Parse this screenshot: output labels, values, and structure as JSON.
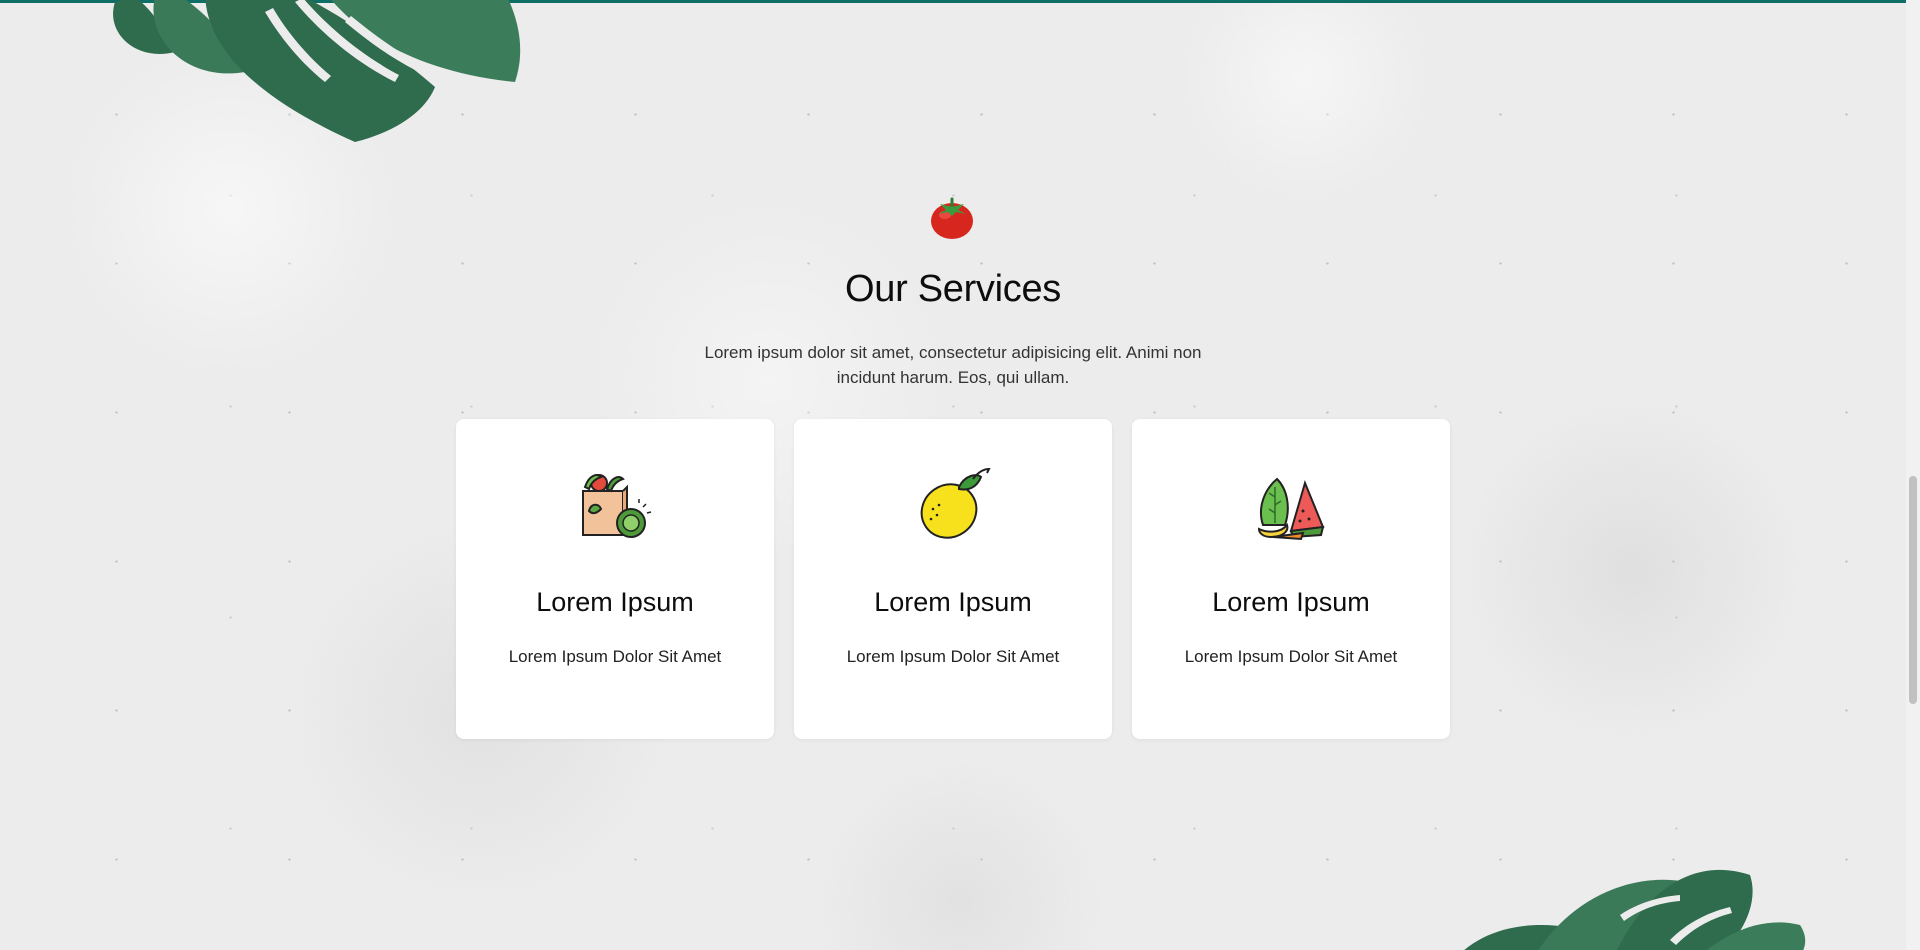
{
  "section": {
    "title": "Our Services",
    "description": "Lorem ipsum dolor sit amet, consectetur adipisicing elit. Animi non incidunt harum. Eos, qui ullam."
  },
  "services": [
    {
      "title": "Lorem Ipsum",
      "text": "Lorem Ipsum Dolor Sit Amet",
      "icon": "grocery-bag-icon"
    },
    {
      "title": "Lorem Ipsum",
      "text": "Lorem Ipsum Dolor Sit Amet",
      "icon": "lemon-icon"
    },
    {
      "title": "Lorem Ipsum",
      "text": "Lorem Ipsum Dolor Sit Amet",
      "icon": "fruits-vegetables-icon"
    }
  ],
  "colors": {
    "accent": "#0f6e66",
    "leaf": "#2f6b4d",
    "card_background": "#ffffff"
  }
}
